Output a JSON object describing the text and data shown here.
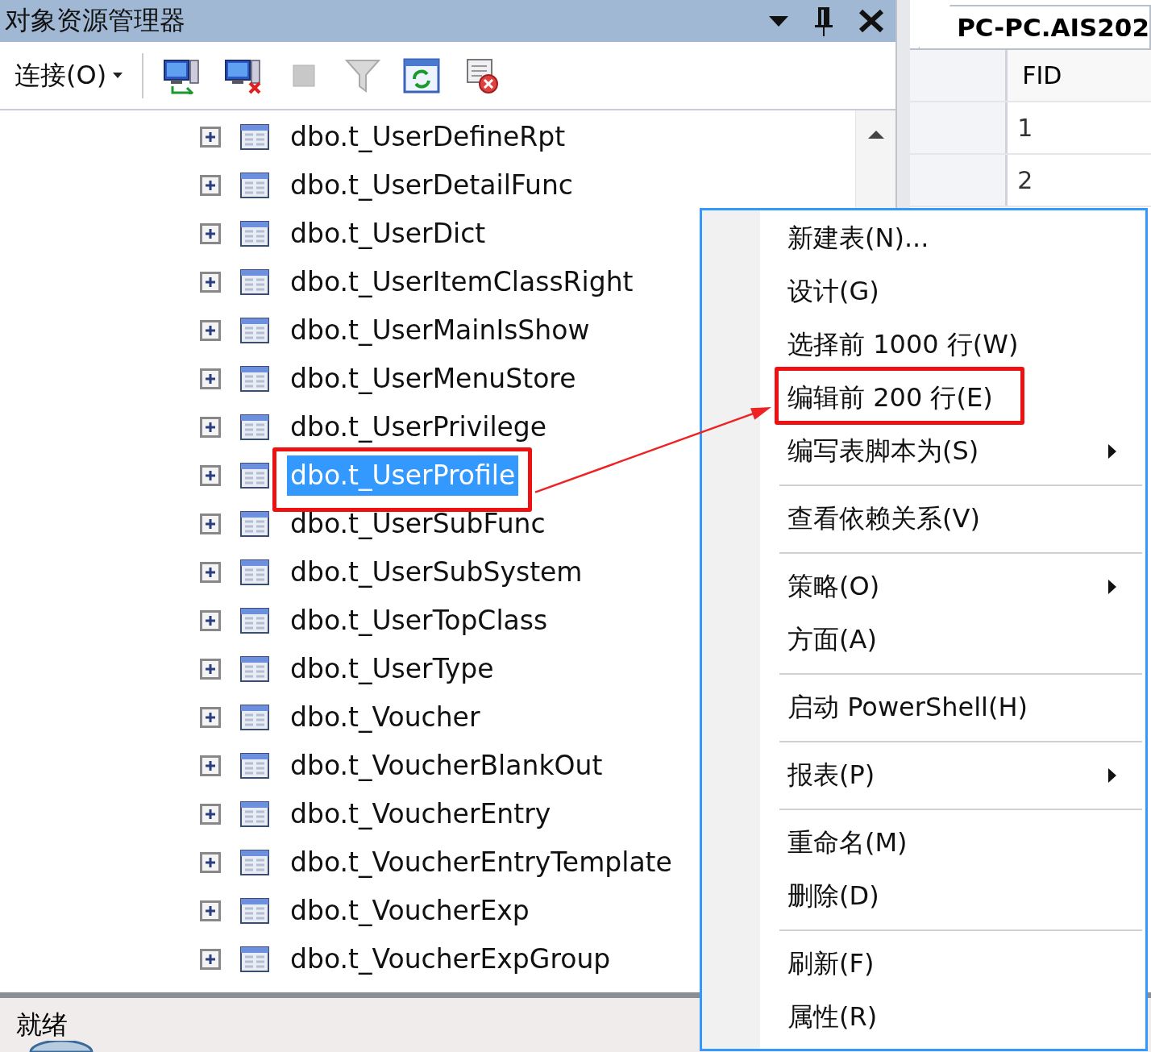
{
  "explorer": {
    "title": "对象资源管理器",
    "toolbar": {
      "connect_label": "连接(O)"
    },
    "tree": [
      {
        "label": "dbo.t_UserDefineRpt",
        "selected": false,
        "annotated": false
      },
      {
        "label": "dbo.t_UserDetailFunc",
        "selected": false,
        "annotated": false
      },
      {
        "label": "dbo.t_UserDict",
        "selected": false,
        "annotated": false
      },
      {
        "label": "dbo.t_UserItemClassRight",
        "selected": false,
        "annotated": false
      },
      {
        "label": "dbo.t_UserMainIsShow",
        "selected": false,
        "annotated": false
      },
      {
        "label": "dbo.t_UserMenuStore",
        "selected": false,
        "annotated": false
      },
      {
        "label": "dbo.t_UserPrivilege",
        "selected": false,
        "annotated": false
      },
      {
        "label": "dbo.t_UserProfile",
        "selected": true,
        "annotated": true
      },
      {
        "label": "dbo.t_UserSubFunc",
        "selected": false,
        "annotated": false
      },
      {
        "label": "dbo.t_UserSubSystem",
        "selected": false,
        "annotated": false
      },
      {
        "label": "dbo.t_UserTopClass",
        "selected": false,
        "annotated": false
      },
      {
        "label": "dbo.t_UserType",
        "selected": false,
        "annotated": false
      },
      {
        "label": "dbo.t_Voucher",
        "selected": false,
        "annotated": false
      },
      {
        "label": "dbo.t_VoucherBlankOut",
        "selected": false,
        "annotated": false
      },
      {
        "label": "dbo.t_VoucherEntry",
        "selected": false,
        "annotated": false
      },
      {
        "label": "dbo.t_VoucherEntryTemplate",
        "selected": false,
        "annotated": false
      },
      {
        "label": "dbo.t_VoucherExp",
        "selected": false,
        "annotated": false
      },
      {
        "label": "dbo.t_VoucherExpGroup",
        "selected": false,
        "annotated": false
      }
    ]
  },
  "document": {
    "tab": "PC-PC.AIS202",
    "columns": [
      "FID"
    ],
    "rows": [
      "1",
      "2"
    ]
  },
  "context_menu": [
    {
      "kind": "item",
      "label": "新建表(N)...",
      "submenu": false,
      "annotated": false
    },
    {
      "kind": "item",
      "label": "设计(G)",
      "submenu": false,
      "annotated": false
    },
    {
      "kind": "item",
      "label": "选择前 1000 行(W)",
      "submenu": false,
      "annotated": false
    },
    {
      "kind": "item",
      "label": "编辑前 200 行(E)",
      "submenu": false,
      "annotated": true
    },
    {
      "kind": "item",
      "label": "编写表脚本为(S)",
      "submenu": true,
      "annotated": false
    },
    {
      "kind": "separator"
    },
    {
      "kind": "item",
      "label": "查看依赖关系(V)",
      "submenu": false,
      "annotated": false
    },
    {
      "kind": "separator"
    },
    {
      "kind": "item",
      "label": "策略(O)",
      "submenu": true,
      "annotated": false
    },
    {
      "kind": "item",
      "label": "方面(A)",
      "submenu": false,
      "annotated": false
    },
    {
      "kind": "separator"
    },
    {
      "kind": "item",
      "label": "启动 PowerShell(H)",
      "submenu": false,
      "annotated": false
    },
    {
      "kind": "separator"
    },
    {
      "kind": "item",
      "label": "报表(P)",
      "submenu": true,
      "annotated": false
    },
    {
      "kind": "separator"
    },
    {
      "kind": "item",
      "label": "重命名(M)",
      "submenu": false,
      "annotated": false
    },
    {
      "kind": "item",
      "label": "删除(D)",
      "submenu": false,
      "annotated": false
    },
    {
      "kind": "separator"
    },
    {
      "kind": "item",
      "label": "刷新(F)",
      "submenu": false,
      "annotated": false
    },
    {
      "kind": "item",
      "label": "属性(R)",
      "submenu": false,
      "annotated": false
    }
  ],
  "status_bar": {
    "text": "就绪"
  }
}
